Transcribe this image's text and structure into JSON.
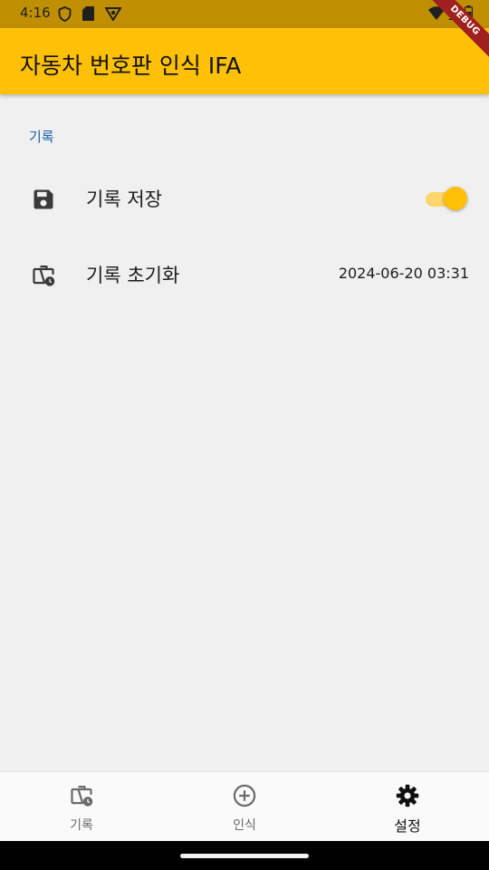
{
  "status_bar": {
    "time": "4:16",
    "icons_left": [
      "shield-icon",
      "sd-card-icon",
      "vpn-icon"
    ],
    "icons_right": [
      "wifi-icon",
      "signal-icon",
      "battery-icon"
    ]
  },
  "app_bar": {
    "title": "자동차 번호판 인식 IFA",
    "color": "#ffc107"
  },
  "debug_banner": "DEBUG",
  "settings": {
    "section_header": "기록",
    "save_history": {
      "label": "기록 저장",
      "icon": "save-icon",
      "enabled": true
    },
    "reset_history": {
      "label": "기록 초기화",
      "icon": "history-briefcase-icon",
      "value": "2024-06-20 03:31"
    }
  },
  "bottom_nav": {
    "items": [
      {
        "label": "기록",
        "icon": "history-briefcase-icon",
        "active": false
      },
      {
        "label": "인식",
        "icon": "add-circle-icon",
        "active": false
      },
      {
        "label": "설정",
        "icon": "gear-icon",
        "active": true
      }
    ]
  }
}
